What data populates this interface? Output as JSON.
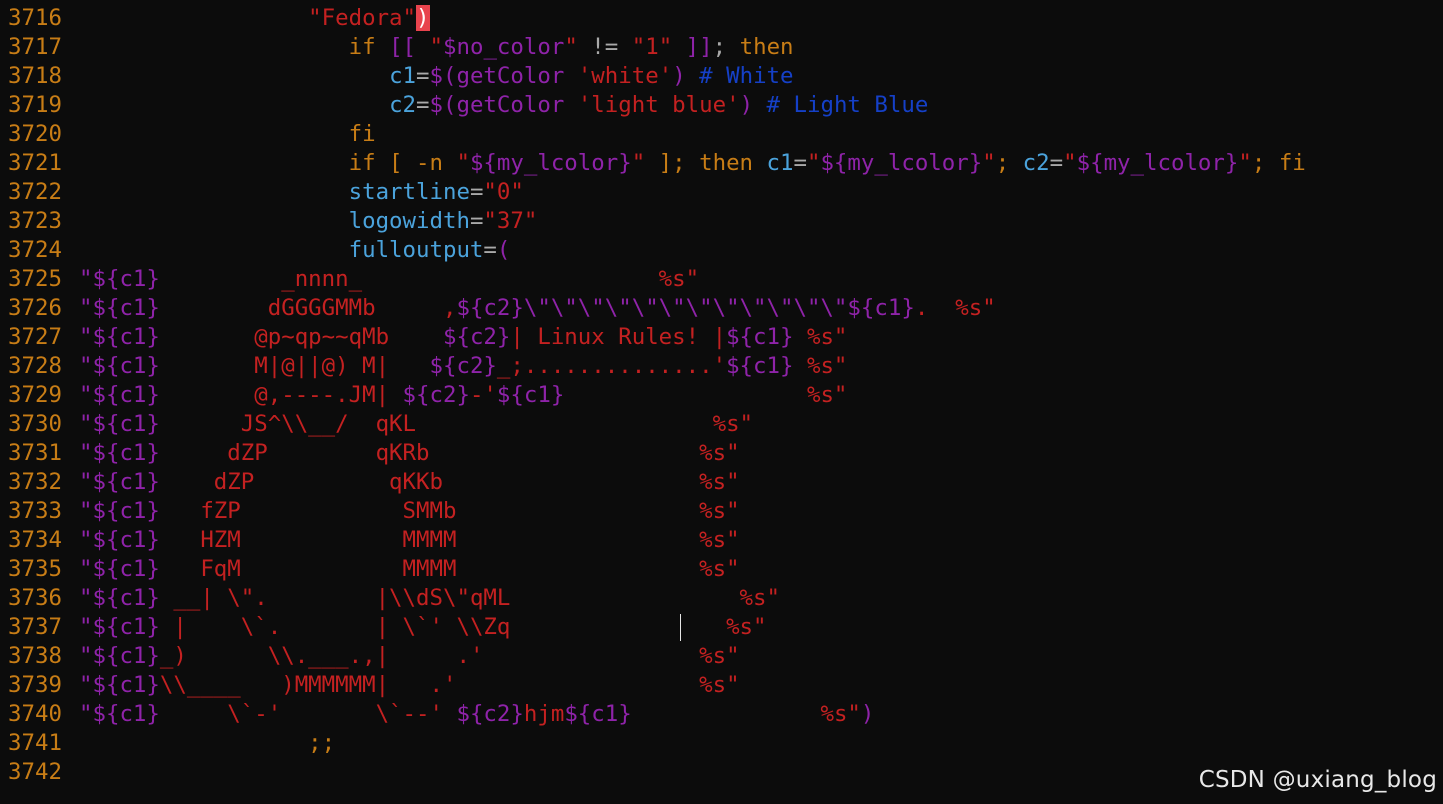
{
  "editor": {
    "lines": [
      {
        "no": "3716",
        "tokens": [
          {
            "t": "                 ",
            "c": "plain"
          },
          {
            "t": "\"Fedora\"",
            "c": "str"
          },
          {
            "t": ")",
            "c": "hl"
          }
        ]
      },
      {
        "no": "3717",
        "tokens": [
          {
            "t": "                    ",
            "c": "plain"
          },
          {
            "t": "if ",
            "c": "kw"
          },
          {
            "t": "[[ ",
            "c": "sub"
          },
          {
            "t": "\"",
            "c": "str"
          },
          {
            "t": "$no_color",
            "c": "sub"
          },
          {
            "t": "\"",
            "c": "str"
          },
          {
            "t": " != ",
            "c": "op"
          },
          {
            "t": "\"1\"",
            "c": "str"
          },
          {
            "t": " ]]",
            "c": "sub"
          },
          {
            "t": "; ",
            "c": "op"
          },
          {
            "t": "then",
            "c": "kw"
          }
        ]
      },
      {
        "no": "3718",
        "tokens": [
          {
            "t": "                       ",
            "c": "plain"
          },
          {
            "t": "c1",
            "c": "var"
          },
          {
            "t": "=",
            "c": "op"
          },
          {
            "t": "$(getColor ",
            "c": "sub"
          },
          {
            "t": "'white'",
            "c": "str"
          },
          {
            "t": ") ",
            "c": "sub"
          },
          {
            "t": "# White",
            "c": "cmt"
          }
        ]
      },
      {
        "no": "3719",
        "tokens": [
          {
            "t": "                       ",
            "c": "plain"
          },
          {
            "t": "c2",
            "c": "var"
          },
          {
            "t": "=",
            "c": "op"
          },
          {
            "t": "$(getColor ",
            "c": "sub"
          },
          {
            "t": "'light blue'",
            "c": "str"
          },
          {
            "t": ") ",
            "c": "sub"
          },
          {
            "t": "# Light Blue",
            "c": "cmt"
          }
        ]
      },
      {
        "no": "3720",
        "tokens": [
          {
            "t": "                    ",
            "c": "plain"
          },
          {
            "t": "fi",
            "c": "kw"
          }
        ]
      },
      {
        "no": "3721",
        "tokens": [
          {
            "t": "                    ",
            "c": "plain"
          },
          {
            "t": "if [ -n ",
            "c": "kw"
          },
          {
            "t": "\"",
            "c": "str"
          },
          {
            "t": "${my_lcolor}",
            "c": "sub"
          },
          {
            "t": "\"",
            "c": "str"
          },
          {
            "t": " ]; then ",
            "c": "kw"
          },
          {
            "t": "c1",
            "c": "var"
          },
          {
            "t": "=",
            "c": "op"
          },
          {
            "t": "\"",
            "c": "str"
          },
          {
            "t": "${my_lcolor}",
            "c": "sub"
          },
          {
            "t": "\"",
            "c": "str"
          },
          {
            "t": "; ",
            "c": "kw"
          },
          {
            "t": "c2",
            "c": "var"
          },
          {
            "t": "=",
            "c": "op"
          },
          {
            "t": "\"",
            "c": "str"
          },
          {
            "t": "${my_lcolor}",
            "c": "sub"
          },
          {
            "t": "\"",
            "c": "str"
          },
          {
            "t": "; fi",
            "c": "kw"
          }
        ]
      },
      {
        "no": "3722",
        "tokens": [
          {
            "t": "                    ",
            "c": "plain"
          },
          {
            "t": "startline",
            "c": "var"
          },
          {
            "t": "=",
            "c": "op"
          },
          {
            "t": "\"0\"",
            "c": "str"
          }
        ]
      },
      {
        "no": "3723",
        "tokens": [
          {
            "t": "                    ",
            "c": "plain"
          },
          {
            "t": "logowidth",
            "c": "var"
          },
          {
            "t": "=",
            "c": "op"
          },
          {
            "t": "\"37\"",
            "c": "str"
          }
        ]
      },
      {
        "no": "3724",
        "tokens": [
          {
            "t": "                    ",
            "c": "plain"
          },
          {
            "t": "fulloutput",
            "c": "var"
          },
          {
            "t": "=",
            "c": "op"
          },
          {
            "t": "(",
            "c": "sub"
          }
        ]
      },
      {
        "no": "3725",
        "tokens": [
          {
            "t": "\"",
            "c": "sub"
          },
          {
            "t": "${c1}",
            "c": "sub"
          },
          {
            "t": "         _nnnn_                      ",
            "c": "str"
          },
          {
            "t": "%s\"",
            "c": "str"
          }
        ]
      },
      {
        "no": "3726",
        "tokens": [
          {
            "t": "\"",
            "c": "sub"
          },
          {
            "t": "${c1}",
            "c": "sub"
          },
          {
            "t": "        dGGGGMMb     ,",
            "c": "str"
          },
          {
            "t": "${c2}\\\"\\\"\\\"\\\"\\\"\\\"\\\"\\\"\\\"\\\"\\\"\\\"${c1}",
            "c": "sub"
          },
          {
            "t": ".  ",
            "c": "str"
          },
          {
            "t": "%s\"",
            "c": "str"
          }
        ]
      },
      {
        "no": "3727",
        "tokens": [
          {
            "t": "\"",
            "c": "sub"
          },
          {
            "t": "${c1}",
            "c": "sub"
          },
          {
            "t": "       @p~qp~~qMb    ",
            "c": "str"
          },
          {
            "t": "${c2}",
            "c": "sub"
          },
          {
            "t": "| Linux Rules! |",
            "c": "str"
          },
          {
            "t": "${c1}",
            "c": "sub"
          },
          {
            "t": " %s\"",
            "c": "str"
          }
        ]
      },
      {
        "no": "3728",
        "tokens": [
          {
            "t": "\"",
            "c": "sub"
          },
          {
            "t": "${c1}",
            "c": "sub"
          },
          {
            "t": "       M|@||@) M|   ",
            "c": "str"
          },
          {
            "t": "${c2}",
            "c": "sub"
          },
          {
            "t": "_;..............'",
            "c": "str"
          },
          {
            "t": "${c1}",
            "c": "sub"
          },
          {
            "t": " %s\"",
            "c": "str"
          }
        ]
      },
      {
        "no": "3729",
        "tokens": [
          {
            "t": "\"",
            "c": "sub"
          },
          {
            "t": "${c1}",
            "c": "sub"
          },
          {
            "t": "       @,----.JM| ",
            "c": "str"
          },
          {
            "t": "${c2}",
            "c": "sub"
          },
          {
            "t": "-'",
            "c": "str"
          },
          {
            "t": "${c1}",
            "c": "sub"
          },
          {
            "t": "                  %s\"",
            "c": "str"
          }
        ]
      },
      {
        "no": "3730",
        "tokens": [
          {
            "t": "\"",
            "c": "sub"
          },
          {
            "t": "${c1}",
            "c": "sub"
          },
          {
            "t": "      JS^\\\\__/  qKL                      %s\"",
            "c": "str"
          }
        ]
      },
      {
        "no": "3731",
        "tokens": [
          {
            "t": "\"",
            "c": "sub"
          },
          {
            "t": "${c1}",
            "c": "sub"
          },
          {
            "t": "     dZP        qKRb                    %s\"",
            "c": "str"
          }
        ]
      },
      {
        "no": "3732",
        "tokens": [
          {
            "t": "\"",
            "c": "sub"
          },
          {
            "t": "${c1}",
            "c": "sub"
          },
          {
            "t": "    dZP          qKKb                   %s\"",
            "c": "str"
          }
        ]
      },
      {
        "no": "3733",
        "tokens": [
          {
            "t": "\"",
            "c": "sub"
          },
          {
            "t": "${c1}",
            "c": "sub"
          },
          {
            "t": "   fZP            SMMb                  %s\"",
            "c": "str"
          }
        ]
      },
      {
        "no": "3734",
        "tokens": [
          {
            "t": "\"",
            "c": "sub"
          },
          {
            "t": "${c1}",
            "c": "sub"
          },
          {
            "t": "   HZM            MMMM                  %s\"",
            "c": "str"
          }
        ]
      },
      {
        "no": "3735",
        "tokens": [
          {
            "t": "\"",
            "c": "sub"
          },
          {
            "t": "${c1}",
            "c": "sub"
          },
          {
            "t": "   FqM            MMMM                  %s\"",
            "c": "str"
          }
        ]
      },
      {
        "no": "3736",
        "tokens": [
          {
            "t": "\"",
            "c": "sub"
          },
          {
            "t": "${c1}",
            "c": "sub"
          },
          {
            "t": " __| \\\".        |\\\\dS\\\"qML                 %s\"",
            "c": "str"
          }
        ]
      },
      {
        "no": "3737",
        "tokens": [
          {
            "t": "\"",
            "c": "sub"
          },
          {
            "t": "${c1}",
            "c": "sub"
          },
          {
            "t": " |    \\`.       | \\`' \\\\Zq                %s\"",
            "c": "str"
          }
        ]
      },
      {
        "no": "3738",
        "tokens": [
          {
            "t": "\"",
            "c": "sub"
          },
          {
            "t": "${c1}",
            "c": "sub"
          },
          {
            "t": "_)      \\\\.___.,|     .'                %s\"",
            "c": "str"
          }
        ]
      },
      {
        "no": "3739",
        "tokens": [
          {
            "t": "\"",
            "c": "sub"
          },
          {
            "t": "${c1}",
            "c": "sub"
          },
          {
            "t": "\\\\____   )MMMMMM|   .'                  %s\"",
            "c": "str"
          }
        ]
      },
      {
        "no": "3740",
        "tokens": [
          {
            "t": "\"",
            "c": "sub"
          },
          {
            "t": "${c1}",
            "c": "sub"
          },
          {
            "t": "     \\`-'       \\`--' ",
            "c": "str"
          },
          {
            "t": "${c2}",
            "c": "sub"
          },
          {
            "t": "hjm",
            "c": "str"
          },
          {
            "t": "${c1}",
            "c": "sub"
          },
          {
            "t": "              %s\"",
            "c": "str"
          },
          {
            "t": ")",
            "c": "sub"
          }
        ]
      },
      {
        "no": "3741",
        "tokens": [
          {
            "t": "                 ",
            "c": "plain"
          },
          {
            "t": ";;",
            "c": "kw"
          }
        ]
      },
      {
        "no": "3742",
        "tokens": []
      }
    ]
  },
  "watermark": {
    "text": "CSDN @uxiang_blog"
  }
}
